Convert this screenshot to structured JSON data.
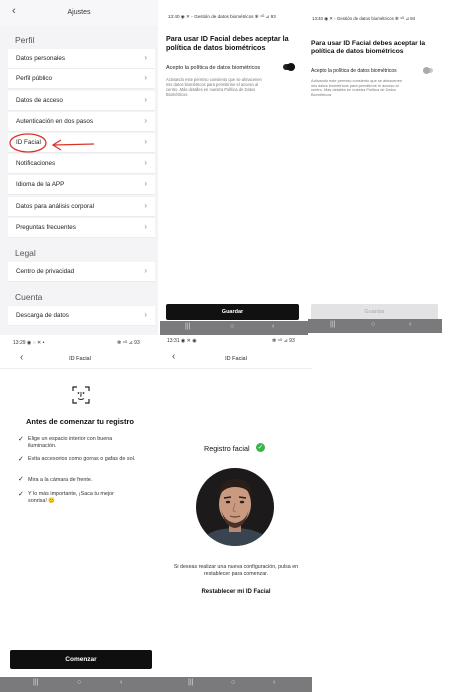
{
  "settings": {
    "title": "Ajustes",
    "sections": [
      {
        "label": "Perfil"
      },
      {
        "label": "Legal"
      },
      {
        "label": "Cuenta"
      }
    ],
    "perfil_items": [
      "Datos personales",
      "Perfil público",
      "Datos de acceso",
      "Autenticación en dos pasos",
      "ID Facial",
      "Notificaciones",
      "Idioma de la APP",
      "Datos para análisis corporal",
      "Preguntas frecuentes"
    ],
    "legal_items": [
      "Centro de privacidad"
    ],
    "cuenta_items": [
      "Descarga de datos"
    ],
    "annotation_color": "#d9342b"
  },
  "bio_dark": {
    "status": "13:40 ◉ ✕ ◦  Gestión de datos biométricos  ✻ ⁴ᴳ ⊿ 93",
    "title": "Para usar ID Facial debes aceptar la política de datos biométricos",
    "accept_label": "Acepto la política de datos biométricos",
    "description": "Activando este permiso consiento que se almacenen mis datos biométricos para permitirme el acceso al centro. Más detalles en nuestra Política de Datos Biométricos",
    "toggle_on": true,
    "button": "Guardar"
  },
  "bio_light": {
    "status": "13:40 ◉ ✕ ◦  Gestión de datos biométricos  ✻ ⁴ᴳ ⊿ 93",
    "title": "Para usar ID Facial debes aceptar la política de datos biométricos",
    "accept_label": "Acepto la política de datos biométricos",
    "description": "Activando este permiso consiento que se almacenen mis datos biométricos para permitirme el acceso al centro. Más detalles en nuestra Política de Datos Biométricos",
    "toggle_on": false,
    "button": "Guardar"
  },
  "face_intro": {
    "status_left": "13:29 ◉ ◌ ✕ •",
    "status_right": "✻ ⁴ᴳ ⊿ 93",
    "header": "ID Facial",
    "heading": "Antes de comenzar tu registro",
    "checks": [
      "Elige un espacio interior con buena iluminación.",
      "Evita accesorios como gorras o gafas de sol.",
      "Mira a la cámara de frente.",
      "Y lo más importante, ¡Saca tu mejor sonrisa! 😊"
    ],
    "button": "Comenzar"
  },
  "face_done": {
    "status_left": "13:31 ◉ ✕ ◉",
    "status_right": "✻ ⁴ᴳ ⊿ 93",
    "header": "ID Facial",
    "title": "Registro facial",
    "note": "Si deseas realizar una nueva configuración, pulsa en restablecer para comenzar.",
    "link": "Restablecer mi ID Facial",
    "success_color": "#3bb54a"
  },
  "nav": {
    "recents": "|||",
    "home": "○",
    "back": "‹"
  }
}
